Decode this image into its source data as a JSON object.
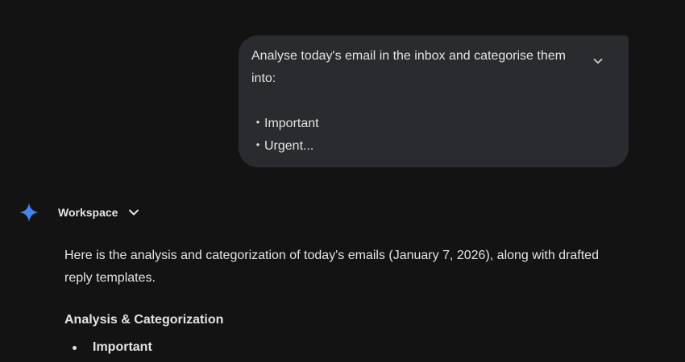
{
  "user_prompt": {
    "line1": "Analyse today's email in the inbox and categorise them",
    "line2": "into:",
    "bullets": [
      "Important",
      "Urgent..."
    ],
    "bullet_marker": "・"
  },
  "response_header": {
    "model_label": "Workspace",
    "icon": "gemini-sparkle-icon",
    "chevron": "chevron-down-icon"
  },
  "response": {
    "intro_line1": "Here is the analysis and categorization of today's emails (January 7, 2026), along with drafted",
    "intro_line2": "reply templates.",
    "section_heading": "Analysis & Categorization",
    "categories": [
      "Important"
    ]
  },
  "colors": {
    "background": "#131314",
    "bubble": "#2a2b2e",
    "text": "#e3e3e3",
    "sparkle_blue": "#4285f4"
  }
}
